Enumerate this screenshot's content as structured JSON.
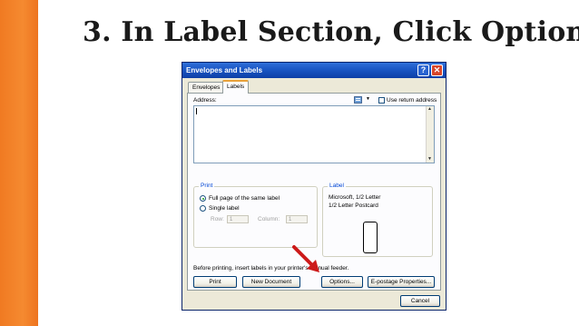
{
  "slide": {
    "title": "3. In Label Section, Click Option"
  },
  "dialog": {
    "title": "Envelopes and Labels",
    "help_button": "?",
    "close_button": "✕",
    "tabs": [
      {
        "label": "Envelopes",
        "active": false
      },
      {
        "label": "Labels",
        "active": true
      }
    ],
    "address_label": "Address:",
    "use_return_address": "Use return address",
    "print_group": {
      "title": "Print",
      "full_page": "Full page of the same label",
      "single_label": "Single label",
      "row_label": "Row:",
      "row_value": "1",
      "column_label": "Column:",
      "column_value": "1"
    },
    "label_group": {
      "title": "Label",
      "line1": "Microsoft, 1/2 Letter",
      "line2": "1/2 Letter Postcard"
    },
    "instruction": "Before printing, insert labels in your printer's manual feeder.",
    "buttons": {
      "print": "Print",
      "new_document": "New Document",
      "options": "Options...",
      "epostage": "E-postage Properties...",
      "cancel": "Cancel"
    }
  },
  "colors": {
    "accent_bar": "#f07a22",
    "titlebar": "#1a56c4",
    "pointer_arrow": "#cc1a1a"
  }
}
